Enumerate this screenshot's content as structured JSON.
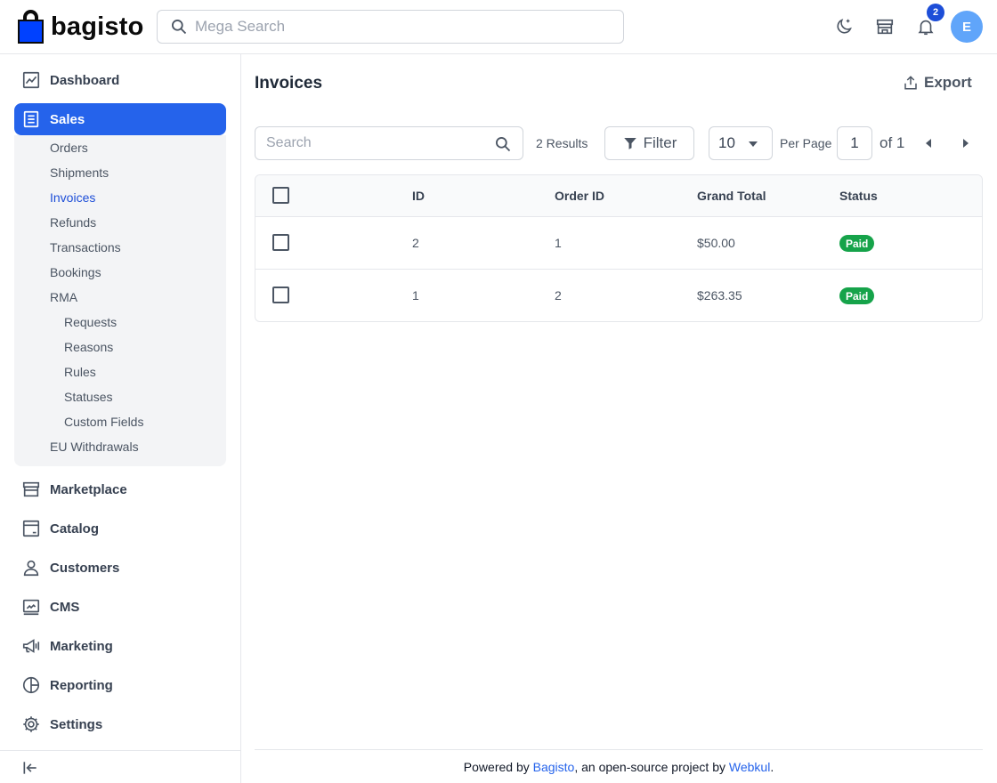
{
  "header": {
    "brand": "bagisto",
    "search_placeholder": "Mega Search",
    "notification_count": "2",
    "avatar_initial": "E"
  },
  "sidebar": {
    "items": [
      {
        "label": "Dashboard",
        "icon": "dashboard-icon"
      },
      {
        "label": "Sales",
        "icon": "sales-icon",
        "active": true
      },
      {
        "label": "Marketplace",
        "icon": "store-icon"
      },
      {
        "label": "Catalog",
        "icon": "catalog-icon"
      },
      {
        "label": "Customers",
        "icon": "customers-icon"
      },
      {
        "label": "CMS",
        "icon": "cms-icon"
      },
      {
        "label": "Marketing",
        "icon": "megaphone-icon"
      },
      {
        "label": "Reporting",
        "icon": "pie-chart-icon"
      },
      {
        "label": "Settings",
        "icon": "gear-icon"
      }
    ],
    "sales_submenu": [
      {
        "label": "Orders"
      },
      {
        "label": "Shipments"
      },
      {
        "label": "Invoices",
        "active": true
      },
      {
        "label": "Refunds"
      },
      {
        "label": "Transactions"
      },
      {
        "label": "Bookings"
      },
      {
        "label": "RMA"
      },
      {
        "label": "Requests"
      },
      {
        "label": "Reasons"
      },
      {
        "label": "Rules"
      },
      {
        "label": "Statuses"
      },
      {
        "label": "Custom Fields"
      },
      {
        "label": "EU Withdrawals"
      }
    ]
  },
  "main": {
    "title": "Invoices",
    "export_label": "Export",
    "search_placeholder": "Search",
    "results_text": "2 Results",
    "filter_label": "Filter",
    "per_page_value": "10",
    "per_page_label": "Per Page",
    "current_page": "1",
    "of_pages": "of 1"
  },
  "table": {
    "columns": [
      "ID",
      "Order ID",
      "Grand Total",
      "Status"
    ],
    "rows": [
      {
        "id": "2",
        "order_id": "1",
        "grand_total": "$50.00",
        "status": "Paid"
      },
      {
        "id": "1",
        "order_id": "2",
        "grand_total": "$263.35",
        "status": "Paid"
      }
    ],
    "status_color": "#16a34a"
  },
  "footer": {
    "prefix": "Powered by ",
    "bagisto_link": "Bagisto",
    "middle": ", an open-source project by ",
    "webkul_link": "Webkul",
    "suffix": "."
  },
  "colors": {
    "accent": "#2563eb",
    "brand_blue": "#0041ff",
    "active_link": "#1d4ed8"
  }
}
